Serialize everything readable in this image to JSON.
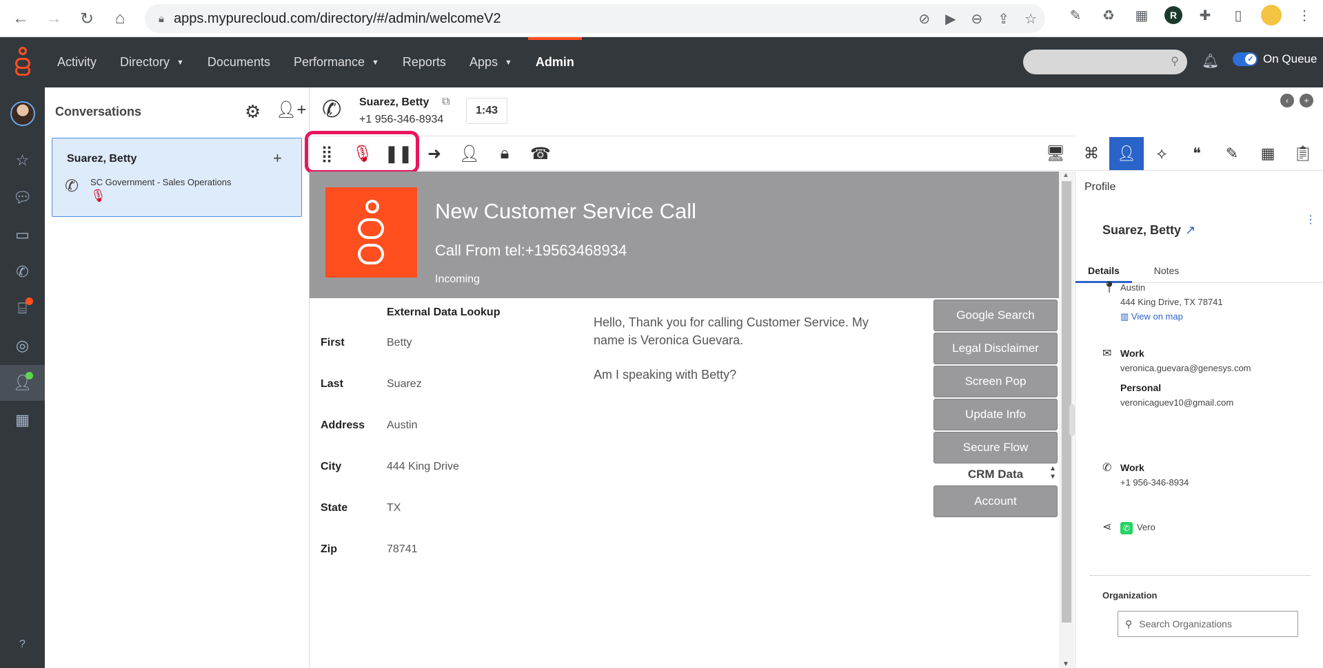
{
  "browser": {
    "url": "apps.mypurecloud.com/directory/#/admin/welcomeV2"
  },
  "app": {
    "nav": [
      {
        "label": "Activity",
        "dropdown": false
      },
      {
        "label": "Directory",
        "dropdown": true
      },
      {
        "label": "Documents",
        "dropdown": false
      },
      {
        "label": "Performance",
        "dropdown": true
      },
      {
        "label": "Reports",
        "dropdown": false
      },
      {
        "label": "Apps",
        "dropdown": true
      },
      {
        "label": "Admin",
        "dropdown": false,
        "active": true
      }
    ],
    "queue_label": "On Queue",
    "accent": "#ff4f1f"
  },
  "conversations": {
    "title": "Conversations",
    "card": {
      "name": "Suarez, Betty",
      "queue": "SC Government - Sales Operations"
    }
  },
  "call": {
    "name": "Suarez, Betty",
    "number": "+1 956-346-8934",
    "timer": "1:43"
  },
  "script": {
    "banner_title": "New Customer Service Call",
    "banner_from": "Call From tel:+19563468934",
    "banner_status": "Incoming",
    "lookup_title": "External Data Lookup",
    "fields": [
      {
        "label": "First",
        "value": "Betty"
      },
      {
        "label": "Last",
        "value": "Suarez"
      },
      {
        "label": "Address",
        "value": "Austin"
      },
      {
        "label": "City",
        "value": "444 King Drive"
      },
      {
        "label": "State",
        "value": "TX"
      },
      {
        "label": "Zip",
        "value": "78741"
      }
    ],
    "greeting": "Hello, Thank you for calling Customer Service. My name is Veronica Guevara.",
    "question": "Am I speaking with Betty?",
    "buttons": [
      "Google Search",
      "Legal Disclaimer",
      "Screen Pop",
      "Update Info",
      "Secure Flow"
    ],
    "crm_label": "CRM Data",
    "account_button": "Account"
  },
  "profile": {
    "panel_title": "Profile",
    "name": "Suarez, Betty",
    "tabs": [
      "Details",
      "Notes"
    ],
    "address_city": "Austin",
    "address_line": "444 King Drive, TX 78741",
    "map_link": "View on map",
    "work_email_label": "Work",
    "work_email": "veronica.guevara@genesys.com",
    "personal_email_label": "Personal",
    "personal_email": "veronicaguev10@gmail.com",
    "work_phone_label": "Work",
    "work_phone": "+1 956-346-8934",
    "social_handle": "Vero",
    "org_title": "Organization",
    "org_placeholder": "Search Organizations"
  }
}
